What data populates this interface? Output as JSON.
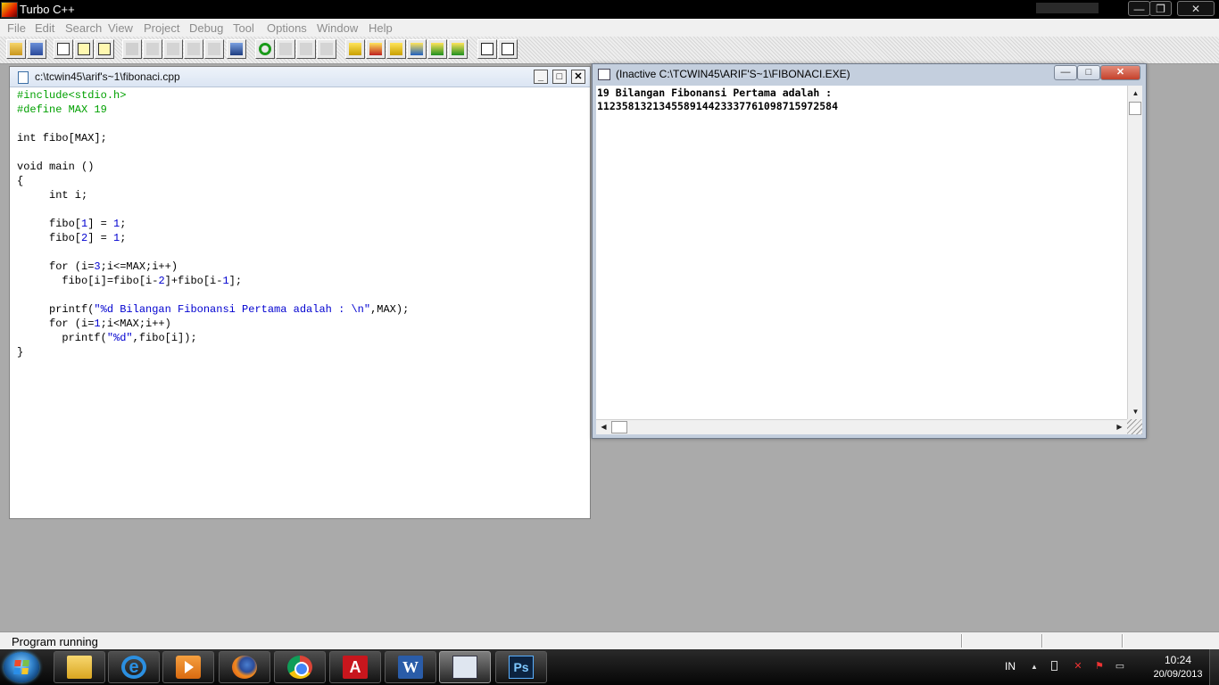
{
  "app": {
    "title": "Turbo C++",
    "caption_buttons": {
      "minimize": "—",
      "maximize": "❐",
      "close": "✕"
    }
  },
  "menu": [
    "File",
    "Edit",
    "Search",
    "View",
    "Project",
    "Debug",
    "Tool",
    "Options",
    "Window",
    "Help"
  ],
  "toolbar": {
    "buttons": [
      "open-icon",
      "save-icon",
      "find-icon",
      "replace-icon",
      "search-again-icon",
      "make-icon",
      "step-over-icon",
      "trace-into-icon",
      "run-to-cursor-icon",
      "evaluate-icon",
      "inspect-icon",
      "undo-icon",
      "cut-icon",
      "copy-icon",
      "paste-icon",
      "compile-icon",
      "make-target-icon",
      "build-icon",
      "run-icon",
      "add-watch-icon",
      "breakpoint-icon",
      "project-icon",
      "message-icon"
    ]
  },
  "editor": {
    "path": "c:\\tcwin45\\arif's~1\\fibonaci.cpp",
    "buttons": {
      "minimize": "_",
      "maximize": "□",
      "close": "✕"
    },
    "code": {
      "l1": "#include<stdio.h>",
      "l2": "#define MAX 19",
      "l4": "int fibo[MAX];",
      "l6": "void main ()",
      "l7": "{",
      "l8": "     int i;",
      "l10a": "     fibo[",
      "l10b": "1",
      "l10c": "] = ",
      "l10d": "1",
      "l10e": ";",
      "l11a": "     fibo[",
      "l11b": "2",
      "l11c": "] = ",
      "l11d": "1",
      "l11e": ";",
      "l13a": "     for (i=",
      "l13b": "3",
      "l13c": ";i<=MAX;i++)",
      "l14a": "       fibo[i]=fibo[i-",
      "l14b": "2",
      "l14c": "]+fibo[i-",
      "l14d": "1",
      "l14e": "];",
      "l16a": "     printf(",
      "l16b": "\"%d Bilangan Fibonansi Pertama adalah : \\n\"",
      "l16c": ",MAX);",
      "l17a": "     for (i=",
      "l17b": "1",
      "l17c": ";i<MAX;i++)",
      "l18a": "       printf(",
      "l18b": "\"%d\"",
      "l18c": ",fibo[i]);",
      "l19": "}"
    }
  },
  "output": {
    "title": "(Inactive C:\\TCWIN45\\ARIF'S~1\\FIBONACI.EXE)",
    "buttons": {
      "minimize": "—",
      "maximize": "□",
      "close": "✕"
    },
    "lines": [
      "19 Bilangan Fibonansi Pertama adalah :",
      "1123581321345589144233377610987159725​84"
    ],
    "scroll": {
      "up": "▲",
      "down": "▼",
      "left": "◀",
      "right": "▶"
    }
  },
  "status": {
    "message": "Program running"
  },
  "taskbar": {
    "apps": [
      {
        "name": "windows-explorer",
        "label": ""
      },
      {
        "name": "internet-explorer",
        "label": "e"
      },
      {
        "name": "media-player",
        "label": ""
      },
      {
        "name": "firefox",
        "label": ""
      },
      {
        "name": "chrome",
        "label": ""
      },
      {
        "name": "adobe-reader",
        "label": "A"
      },
      {
        "name": "word",
        "label": "W"
      },
      {
        "name": "turbo-cpp",
        "label": ""
      },
      {
        "name": "photoshop",
        "label": "Ps"
      }
    ],
    "tray": {
      "language": "IN",
      "show_hidden": "▲",
      "time": "10:24",
      "date": "20/09/2013"
    }
  }
}
